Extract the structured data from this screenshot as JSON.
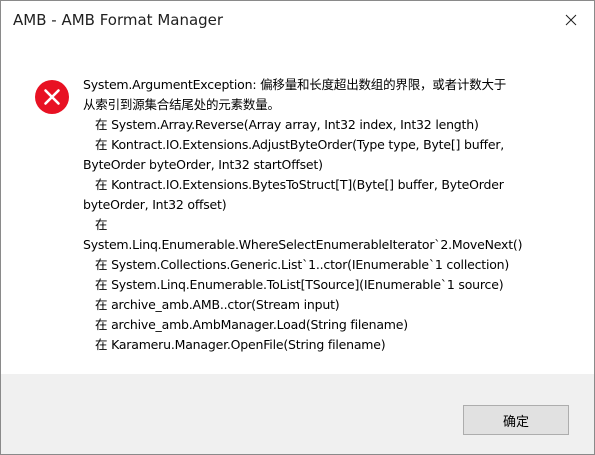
{
  "window": {
    "title": "AMB - AMB Format Manager",
    "close_icon": "close-icon"
  },
  "dialog": {
    "icon": "error-icon",
    "icon_color": "#e81123",
    "message_lines": [
      "System.ArgumentException: 偏移量和长度超出数组的界限，或者计数大于",
      "从索引到源集合结尾处的元素数量。",
      "在 System.Array.Reverse(Array array, Int32 index, Int32 length)",
      "在 Kontract.IO.Extensions.AdjustByteOrder(Type type, Byte[] buffer,",
      "ByteOrder byteOrder, Int32 startOffset)",
      "在 Kontract.IO.Extensions.BytesToStruct[T](Byte[] buffer, ByteOrder",
      "byteOrder, Int32 offset)",
      "在",
      "System.Linq.Enumerable.WhereSelectEnumerableIterator`2.MoveNext()",
      "在 System.Collections.Generic.List`1..ctor(IEnumerable`1 collection)",
      "在 System.Linq.Enumerable.ToList[TSource](IEnumerable`1 source)",
      "在 archive_amb.AMB..ctor(Stream input)",
      "在 archive_amb.AmbManager.Load(String filename)",
      "在 Karameru.Manager.OpenFile(String filename)"
    ]
  },
  "footer": {
    "ok_label": "确定"
  }
}
